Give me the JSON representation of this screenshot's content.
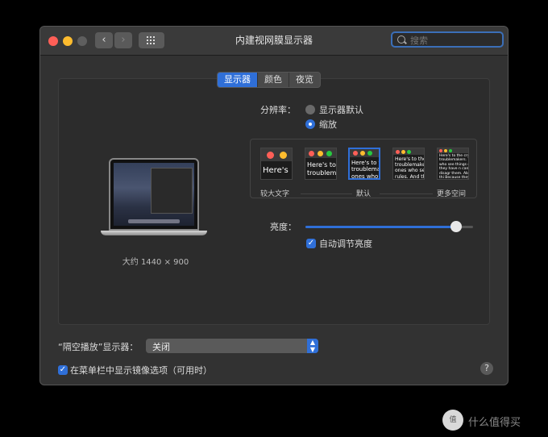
{
  "window": {
    "title": "内建视网膜显示器",
    "search_placeholder": "搜索",
    "nav_back": "‹",
    "nav_forward": "›"
  },
  "tabs": [
    {
      "label": "显示器",
      "active": true
    },
    {
      "label": "颜色",
      "active": false
    },
    {
      "label": "夜览",
      "active": false
    }
  ],
  "display": {
    "resolution_caption": "大约 1440 × 900",
    "resolution_label": "分辨率：",
    "options": [
      {
        "label": "显示器默认",
        "selected": false
      },
      {
        "label": "缩放",
        "selected": true
      }
    ],
    "scale_previews": [
      {
        "text": "Here's",
        "selected": false
      },
      {
        "text": "Here's to troublem",
        "selected": false
      },
      {
        "text": "Here's to t troublema ones who",
        "selected": true
      },
      {
        "text": "Here's to the c troublemakers. ones who see t rules. And they",
        "selected": false
      },
      {
        "text": "Here's to the crazy one troublemakers. The ro ones who see things di rules. And they have n can quote them, disagr them. About the only thi Because they change th",
        "selected": false
      }
    ],
    "scale_labels": {
      "left": "较大文字",
      "middle": "默认",
      "right": "更多空间"
    },
    "brightness_label": "亮度：",
    "brightness_level": 0.9,
    "auto_brightness_label": "自动调节亮度",
    "auto_brightness_checked": true
  },
  "airplay": {
    "label": "“隔空播放”显示器：",
    "value": "关闭"
  },
  "mirroring": {
    "label": "在菜单栏中显示镜像选项（可用时）",
    "checked": true
  },
  "help_label": "?",
  "watermark": {
    "icon_text": "值",
    "text": "什么值得买"
  },
  "colors": {
    "accent": "#2f6fd8",
    "window_bg": "#323232",
    "close": "#ff5f57",
    "minimize": "#febc2e"
  }
}
